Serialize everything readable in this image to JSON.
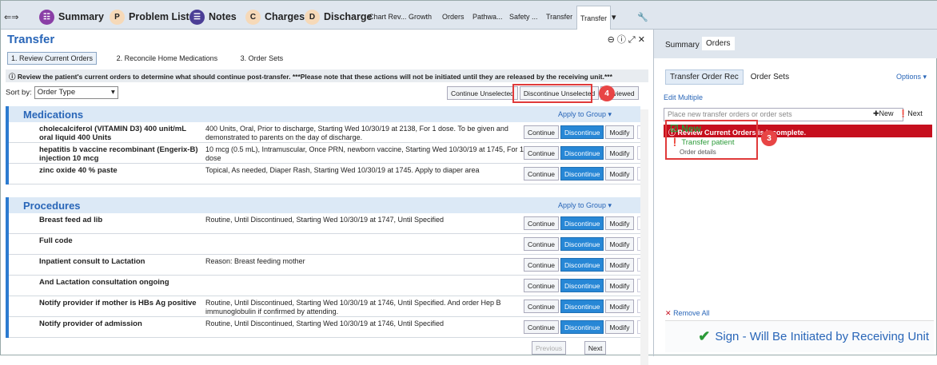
{
  "tabs": {
    "summary": "Summary",
    "problem": "Problem List ...",
    "notes": "Notes",
    "charges": "Charges",
    "discharge": "Discharge",
    "chartrev": "Chart Rev...",
    "growth": "Growth",
    "orders": "Orders",
    "pathwa": "Pathwa...",
    "safety": "Safety ...",
    "transfer1": "Transfer",
    "transfer2": "Transfer",
    "summaryR": "Summary",
    "ordersR": "Orders"
  },
  "letters": {
    "p": "P",
    "c": "C",
    "d": "D"
  },
  "page": {
    "title": "Transfer"
  },
  "subtabs": [
    "1. Review Current Orders",
    "2. Reconcile Home Medications",
    "3. Order Sets"
  ],
  "notice": "Review the patient's current orders to determine what should continue post-transfer. ***Please note that these actions will not be initiated until they are released by the receiving unit.***",
  "sort": {
    "label": "Sort by:",
    "value": "Order Type"
  },
  "buttons": {
    "continue_unselected": "Continue Unselected",
    "discontinue_unselected": "Discontinue Unselected",
    "reviewed": "Reviewed",
    "continue": "Continue",
    "discontinue": "Discontinue",
    "modify": "Modify",
    "apply": "Apply to Group ▾",
    "previous": "Previous",
    "next": "Next"
  },
  "medications": {
    "header": "Medications",
    "rows": [
      {
        "name": "cholecalciferol (VITAMIN D3) 400 unit/mL oral liquid 400 Units",
        "desc": "400 Units, Oral, Prior to discharge, Starting Wed 10/30/19 at 2138, For 1 dose. To be given and demonstrated to parents on the day of discharge."
      },
      {
        "name": "hepatitis b vaccine recombinant (Engerix-B) injection 10 mcg",
        "desc": "10 mcg (0.5 mL), Intramuscular, Once PRN, newborn vaccine, Starting Wed 10/30/19 at 1745, For 1 dose"
      },
      {
        "name": "zinc oxide 40 % paste",
        "desc": "Topical, As needed, Diaper Rash, Starting Wed 10/30/19 at 1745. Apply to diaper area"
      }
    ]
  },
  "procedures": {
    "header": "Procedures",
    "rows": [
      {
        "name": "Breast feed ad lib",
        "desc": "Routine, Until Discontinued, Starting Wed 10/30/19 at 1747, Until Specified"
      },
      {
        "name": "Full code",
        "desc": ""
      },
      {
        "name": "Inpatient consult to Lactation",
        "desc": "Reason: Breast feeding mother"
      },
      {
        "name": "And  Lactation consultation ongoing",
        "desc": ""
      },
      {
        "name": "Notify provider if mother is HBs Ag positive",
        "desc": "Routine, Until Discontinued, Starting Wed 10/30/19 at 1746, Until Specified. And order Hep B immunoglobulin if confirmed by attending."
      },
      {
        "name": "Notify provider of admission",
        "desc": "Routine, Until Discontinued, Starting Wed 10/30/19 at 1746, Until Specified"
      }
    ]
  },
  "right": {
    "tab1": "Transfer Order Rec",
    "tab2": "Order Sets",
    "options": "Options ▾",
    "edit_multiple": "Edit Multiple",
    "placeholder": "Place new transfer orders or order sets",
    "new": "New",
    "next": "Next",
    "error": "Review Current Orders is incomplete.",
    "new_label": "New",
    "order": "Transfer patient",
    "order_detail": "Order details",
    "remove_all": "Remove All",
    "sign": "Sign - Will Be Initiated by Receiving Unit"
  },
  "callouts": {
    "c3": "3",
    "c4": "4"
  },
  "colors": {
    "accent": "#2c7bd0",
    "discontinue": "#2787d6",
    "error": "#c60f1e",
    "success": "#2b9a38",
    "callout": "#e03a3a"
  }
}
